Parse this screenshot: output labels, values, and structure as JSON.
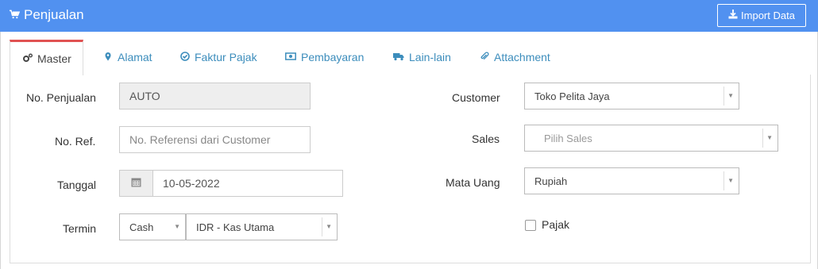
{
  "header": {
    "title": "Penjualan",
    "import_label": "Import Data"
  },
  "tabs": [
    {
      "label": "Master",
      "icon": "cogs-icon",
      "active": true
    },
    {
      "label": "Alamat",
      "icon": "map-marker-icon"
    },
    {
      "label": "Faktur Pajak",
      "icon": "check-circle-icon"
    },
    {
      "label": "Pembayaran",
      "icon": "money-icon"
    },
    {
      "label": "Lain-lain",
      "icon": "truck-icon"
    },
    {
      "label": "Attachment",
      "icon": "paperclip-icon"
    }
  ],
  "form": {
    "no_penjualan": {
      "label": "No. Penjualan",
      "value": "AUTO"
    },
    "no_ref": {
      "label": "No. Ref.",
      "placeholder": "No. Referensi dari Customer"
    },
    "tanggal": {
      "label": "Tanggal",
      "value": "10-05-2022"
    },
    "termin": {
      "label": "Termin",
      "value": "Cash",
      "account": "IDR - Kas Utama"
    },
    "customer": {
      "label": "Customer",
      "value": "Toko Pelita Jaya"
    },
    "sales": {
      "label": "Sales",
      "placeholder": "Pilih Sales"
    },
    "mata_uang": {
      "label": "Mata Uang",
      "value": "Rupiah"
    },
    "pajak": {
      "label": "Pajak",
      "checked": false
    }
  },
  "colors": {
    "header_bg": "#5191f0",
    "active_tab_border": "#e05252",
    "link": "#3c8dbc"
  }
}
